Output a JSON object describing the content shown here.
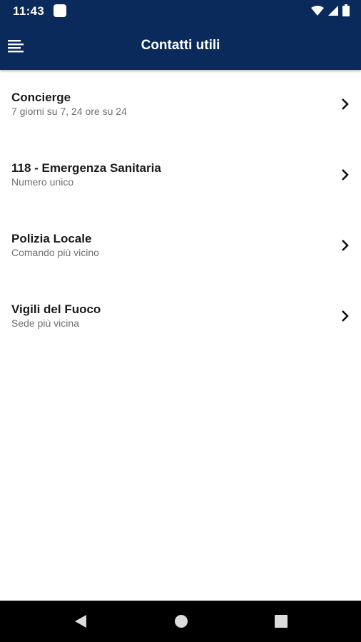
{
  "status_bar": {
    "time": "11:43",
    "icons": [
      "notification-icon",
      "wifi-icon",
      "signal-icon",
      "battery-icon"
    ]
  },
  "app_bar": {
    "title": "Contatti utili",
    "menu_icon": "menu-icon"
  },
  "contacts": [
    {
      "title": "Concierge",
      "subtitle": "7 giorni su 7, 24 ore su 24"
    },
    {
      "title": "118 - Emergenza Sanitaria",
      "subtitle": "Numero unico"
    },
    {
      "title": "Polizia Locale",
      "subtitle": "Comando più vicino"
    },
    {
      "title": "Vigili del Fuoco",
      "subtitle": "Sede più vicina"
    }
  ],
  "nav_bar": {
    "buttons": [
      "back-icon",
      "home-icon",
      "recents-icon"
    ]
  },
  "colors": {
    "primary": "#0a2a5c",
    "title_text": "#1a1a1a",
    "subtitle_text": "#707070",
    "nav_background": "#000000"
  }
}
